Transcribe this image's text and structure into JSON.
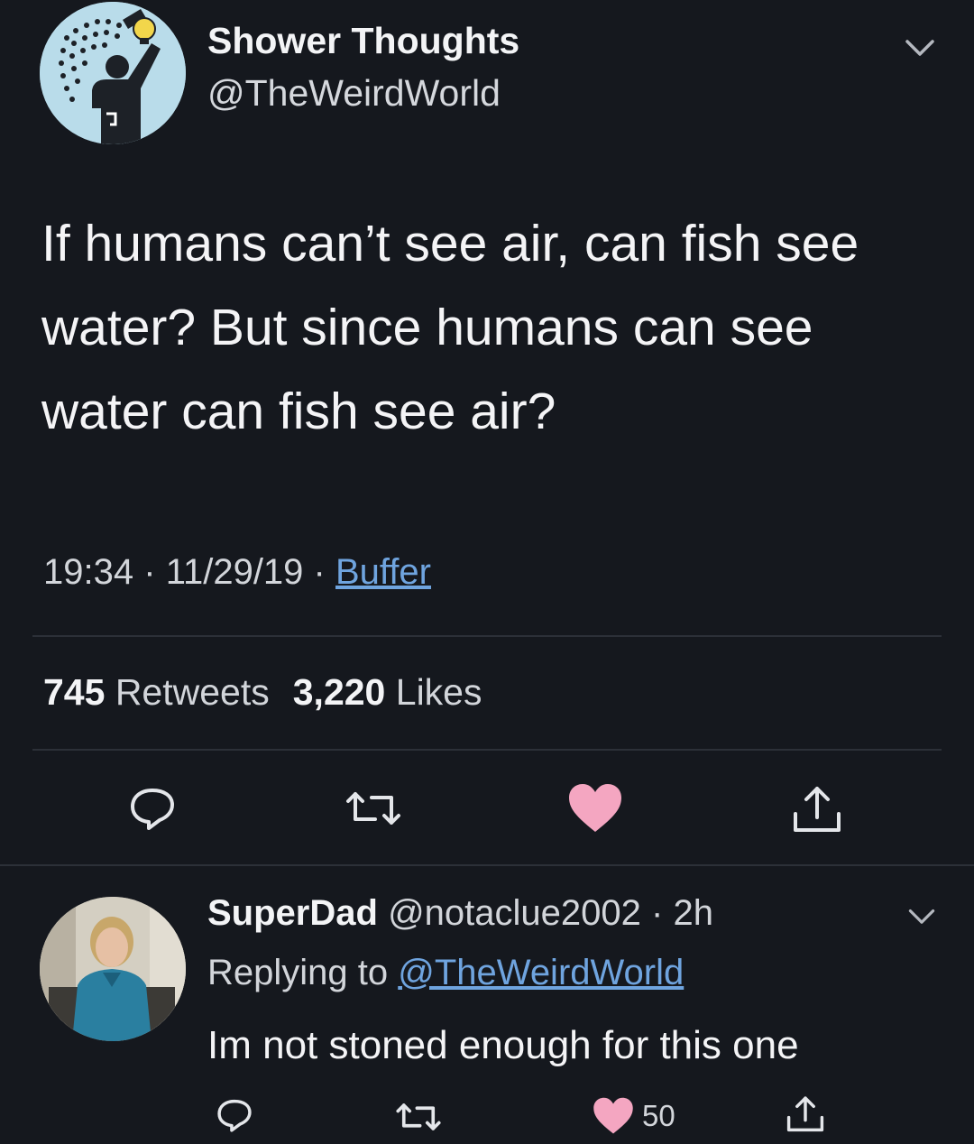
{
  "tweet": {
    "display_name": "Shower Thoughts",
    "handle": "@TheWeirdWorld",
    "text": "If humans can’t see air, can fish see water? But since humans can see water can fish see air?",
    "time": "19:34",
    "date": "11/29/19",
    "source": "Buffer",
    "separator": "·",
    "retweets_count": "745",
    "retweets_label": "Retweets",
    "likes_count": "3,220",
    "likes_label": "Likes",
    "liked": true
  },
  "reply": {
    "display_name": "SuperDad",
    "handle": "@notaclue2002",
    "separator": "·",
    "age": "2h",
    "replying_prefix": "Replying to",
    "replying_to": "@TheWeirdWorld",
    "text": "Im not stoned enough for this one",
    "likes_count": "50",
    "liked": true
  },
  "colors": {
    "background": "#15181e",
    "link": "#6fa4df",
    "heart": "#f4a6c1",
    "divider": "#2c3038"
  },
  "icons": {
    "reply": "speech-bubble",
    "retweet": "retweet-arrows",
    "like": "heart",
    "share": "share-upload",
    "menu": "chevron-down"
  }
}
